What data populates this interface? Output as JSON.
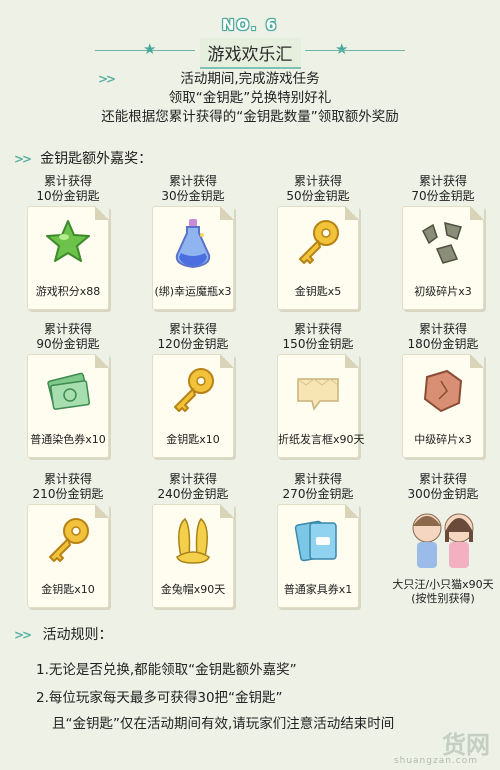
{
  "header": {
    "no": "NO. 6",
    "title": "游戏欢乐汇"
  },
  "intro": [
    "活动期间,完成游戏任务",
    "领取“金钥匙”兑换特别好礼",
    "还能根据您累计获得的“金钥匙数量”领取额外奖励"
  ],
  "section_bonus": "金钥匙额外嘉奖：",
  "rewards": [
    {
      "line1": "累计获得",
      "line2": "10份金钥匙",
      "name": "游戏积分x88",
      "icon": "green-star-icon"
    },
    {
      "line1": "累计获得",
      "line2": "30份金钥匙",
      "name": "(绑)幸运魔瓶x3",
      "icon": "magic-bottle-icon"
    },
    {
      "line1": "累计获得",
      "line2": "50份金钥匙",
      "name": "金钥匙x5",
      "icon": "gold-key-icon"
    },
    {
      "line1": "累计获得",
      "line2": "70份金钥匙",
      "name": "初级碎片x3",
      "icon": "stone-fragments-icon"
    },
    {
      "line1": "累计获得",
      "line2": "90份金钥匙",
      "name": "普通染色券x10",
      "icon": "dye-ticket-icon"
    },
    {
      "line1": "累计获得",
      "line2": "120份金钥匙",
      "name": "金钥匙x10",
      "icon": "gold-key-icon"
    },
    {
      "line1": "累计获得",
      "line2": "150份金钥匙",
      "name": "折纸发言框x90天",
      "icon": "paper-bubble-icon"
    },
    {
      "line1": "累计获得",
      "line2": "180份金钥匙",
      "name": "中级碎片x3",
      "icon": "rock-fragment-icon"
    },
    {
      "line1": "累计获得",
      "line2": "210份金钥匙",
      "name": "金钥匙x10",
      "icon": "gold-key-icon"
    },
    {
      "line1": "累计获得",
      "line2": "240份金钥匙",
      "name": "金兔帽x90天",
      "icon": "bunny-ears-icon"
    },
    {
      "line1": "累计获得",
      "line2": "270份金钥匙",
      "name": "普通家具券x1",
      "icon": "furniture-ticket-icon"
    },
    {
      "line1": "累计获得",
      "line2": "300份金钥匙",
      "name": "大只汪/小只猫x90天",
      "name2": "(按性别获得)",
      "icon": "couple-avatars-icon"
    }
  ],
  "section_rules": "活动规则：",
  "rules": [
    "1.无论是否兑换,都能领取“金钥匙额外嘉奖”",
    "2.每位玩家每天最多可获得30把“金钥匙”",
    "且“金钥匙”仅在活动期间有效,请玩家们注意活动结束时间"
  ],
  "watermark": {
    "main": "货网",
    "sub": "shuangzan.com"
  },
  "colors": {
    "accent": "#4aa89a",
    "background": "#eef1e6",
    "card": "#fffdf0"
  }
}
